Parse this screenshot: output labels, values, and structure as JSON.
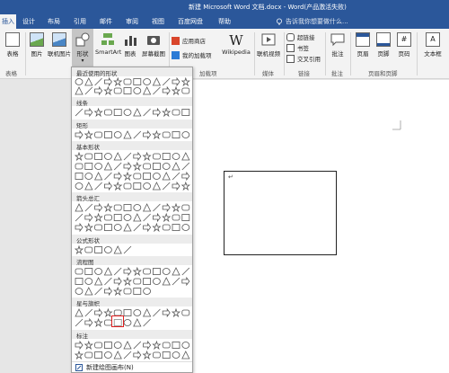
{
  "window": {
    "title": "新建 Microsoft Word 文档.docx - Word(产品激活失败)"
  },
  "tabs": [
    {
      "label": "插入",
      "active": true
    },
    {
      "label": "设计"
    },
    {
      "label": "布局"
    },
    {
      "label": "引用"
    },
    {
      "label": "邮件"
    },
    {
      "label": "审阅"
    },
    {
      "label": "视图"
    },
    {
      "label": "百度网盘"
    },
    {
      "label": "帮助"
    }
  ],
  "tell_me": {
    "placeholder": "告诉我你想要做什么..."
  },
  "ribbon": {
    "table": "表格",
    "picture": "图片",
    "online_picture": "联机图片",
    "shapes": "形状",
    "smartart": "SmartArt",
    "chart": "图表",
    "screenshot": "屏幕截图",
    "app_store": "应用商店",
    "my_addins": "我的加载项",
    "wikipedia": "Wikipedia",
    "online_video": "联机视频",
    "link": "超链接",
    "bookmark": "书签",
    "cross_ref": "交叉引用",
    "comment": "批注",
    "header": "页眉",
    "footer": "页脚",
    "page_number": "页码",
    "textbox": "文本框",
    "groups": {
      "tables": "表格",
      "addins": "加载项",
      "media": "媒体",
      "links": "链接",
      "comments": "批注",
      "header_footer": "页眉和页脚"
    }
  },
  "shapes_menu": {
    "categories": [
      "最近使用的形状",
      "线条",
      "矩形",
      "基本形状",
      "箭头总汇",
      "公式形状",
      "流程图",
      "星与旗帜",
      "标注"
    ],
    "new_canvas": "新建绘图画布(N)"
  },
  "document": {
    "paragraph_mark": "↵"
  }
}
